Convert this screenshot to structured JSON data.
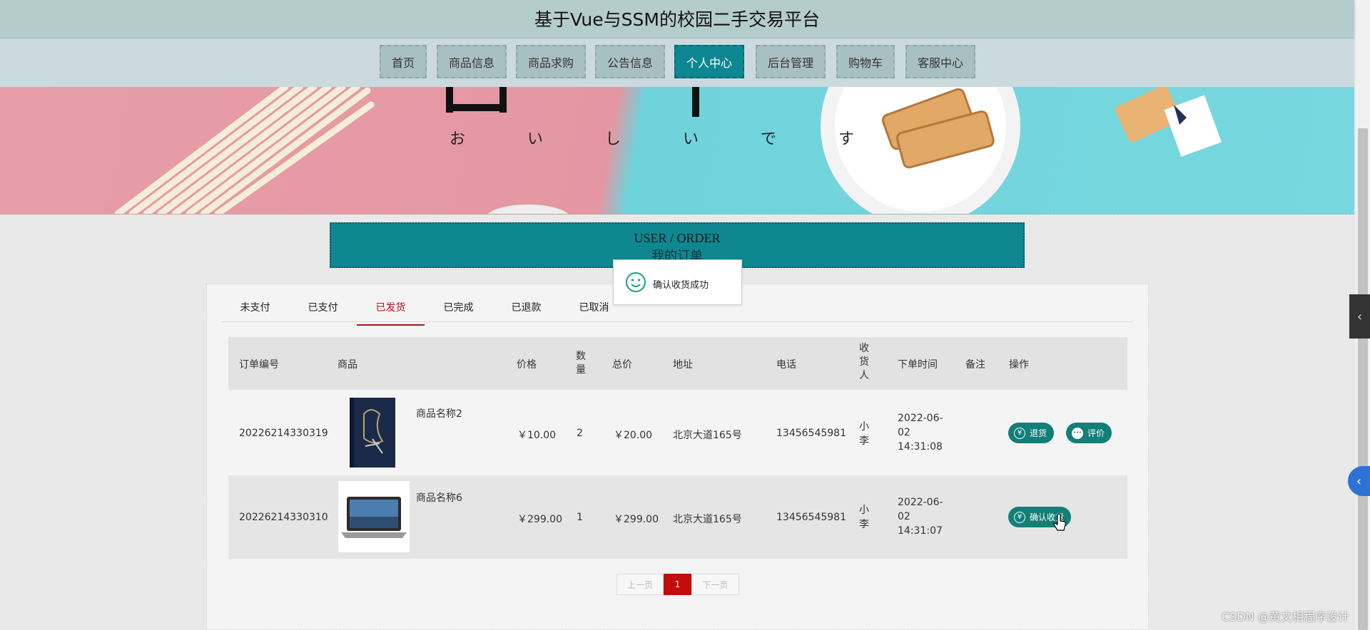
{
  "header": {
    "title": "基于Vue与SSM的校园二手交易平台"
  },
  "nav": {
    "items": [
      {
        "label": "首页"
      },
      {
        "label": "商品信息"
      },
      {
        "label": "商品求购"
      },
      {
        "label": "公告信息"
      },
      {
        "label": "个人中心",
        "active": true
      },
      {
        "label": "后台管理"
      },
      {
        "label": "购物车"
      },
      {
        "label": "客服中心"
      }
    ]
  },
  "banner": {
    "text": "お い し い で す"
  },
  "page_heading": {
    "en": "USER / ORDER",
    "cn": "我的订单"
  },
  "toast": {
    "message": "确认收货成功",
    "icon": "smile-icon"
  },
  "tabs": [
    {
      "label": "未支付"
    },
    {
      "label": "已支付"
    },
    {
      "label": "已发货",
      "active": true
    },
    {
      "label": "已完成"
    },
    {
      "label": "已退款"
    },
    {
      "label": "已取消"
    }
  ],
  "table": {
    "headers": {
      "order_no": "订单编号",
      "product": "商品",
      "price": "价格",
      "qty": "数量",
      "total": "总价",
      "address": "地址",
      "phone": "电话",
      "receiver": "收货人",
      "order_time": "下单时间",
      "remark": "备注",
      "actions": "操作"
    },
    "rows": [
      {
        "order_no": "20226214330319",
        "product_name": "商品名称2",
        "price": "￥10.00",
        "qty": "2",
        "total": "￥20.00",
        "address": "北京大道165号",
        "phone": "13456545981",
        "receiver": "小李",
        "order_time_date": "2022-06-",
        "order_time_day": "02",
        "order_time_clock": "14:31:08",
        "remark": "",
        "buttons": [
          {
            "label": "退货",
            "icon": "yen-icon"
          },
          {
            "label": "评价",
            "icon": "comment-icon"
          }
        ]
      },
      {
        "order_no": "20226214330310",
        "product_name": "商品名称6",
        "price": "￥299.00",
        "qty": "1",
        "total": "￥299.00",
        "address": "北京大道165号",
        "phone": "13456545981",
        "receiver": "小李",
        "order_time_date": "2022-06-",
        "order_time_day": "02",
        "order_time_clock": "14:31:07",
        "remark": "",
        "buttons": [
          {
            "label": "确认收货",
            "icon": "yen-icon"
          }
        ]
      }
    ]
  },
  "pagination": {
    "prev": "上一页",
    "current": "1",
    "next": "下一页"
  },
  "watermark": "CSDN @黄文相程序设计",
  "colors": {
    "accent": "#0f8793",
    "active_tab": "#b3101a",
    "button": "#127f78",
    "page_current": "#c40c0c"
  }
}
